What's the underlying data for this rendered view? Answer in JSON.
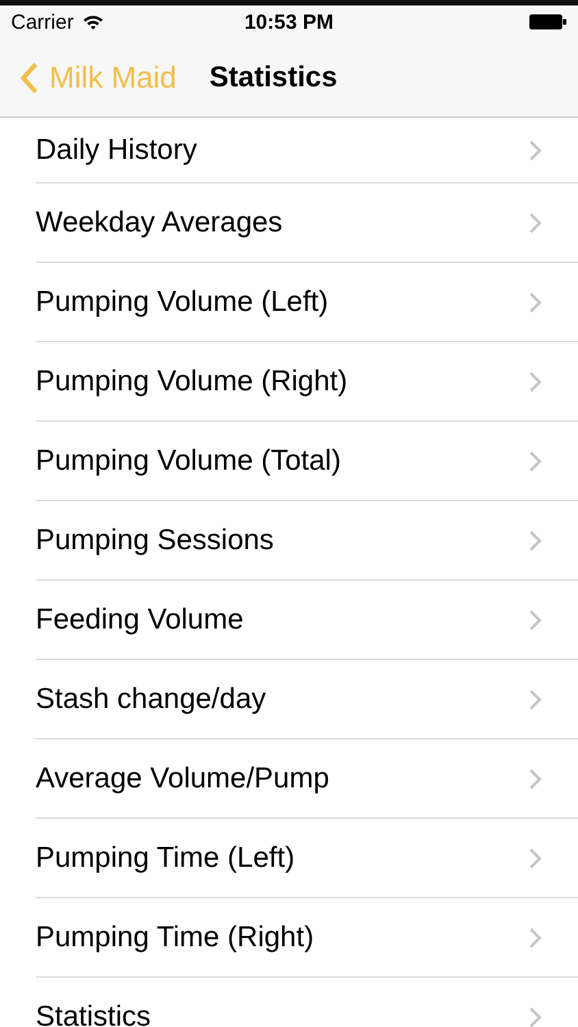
{
  "status_bar": {
    "carrier": "Carrier",
    "time": "10:53 PM"
  },
  "nav_bar": {
    "back_label": "Milk Maid",
    "title": "Statistics"
  },
  "rows": [
    {
      "label": "Daily History"
    },
    {
      "label": "Weekday Averages"
    },
    {
      "label": "Pumping Volume (Left)"
    },
    {
      "label": "Pumping Volume (Right)"
    },
    {
      "label": "Pumping Volume (Total)"
    },
    {
      "label": "Pumping Sessions"
    },
    {
      "label": "Feeding Volume"
    },
    {
      "label": "Stash change/day"
    },
    {
      "label": "Average Volume/Pump"
    },
    {
      "label": "Pumping Time (Left)"
    },
    {
      "label": "Pumping Time (Right)"
    },
    {
      "label": "Statistics"
    }
  ]
}
